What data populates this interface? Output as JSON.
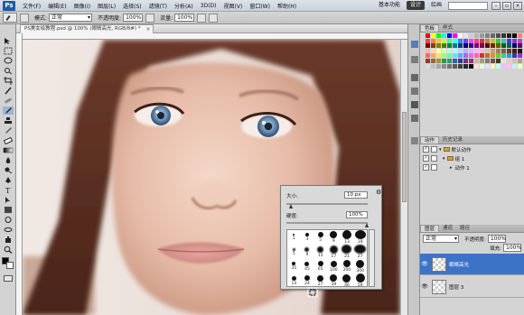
{
  "app": {
    "logo": "Ps",
    "menu": [
      "文件(F)",
      "编辑(E)",
      "图像(I)",
      "图层(L)",
      "选择(S)",
      "滤镜(T)",
      "分析(A)",
      "3D(D)",
      "视图(V)",
      "窗口(W)",
      "帮助(H)"
    ],
    "workspaces": {
      "basic": "基本功能",
      "design": "设计",
      "painting": "绘画"
    }
  },
  "options": {
    "mode_label": "模式:",
    "mode_value": "正常",
    "opacity_label": "不透明度:",
    "opacity_value": "100%",
    "flow_label": "流量:",
    "flow_value": "100%"
  },
  "document": {
    "tab_title": "PS美女绘教程.psd @ 100% (眼睛高光, RGB/8#) *",
    "close": "×"
  },
  "brush_popup": {
    "size_label": "大小:",
    "size_value": "10 px",
    "hardness_label": "硬度:",
    "hardness_value": "100%",
    "presets": [
      {
        "num": "1"
      },
      {
        "num": "3"
      },
      {
        "num": "5"
      },
      {
        "num": "9"
      },
      {
        "num": "13"
      },
      {
        "num": "19"
      },
      {
        "num": "5"
      },
      {
        "num": "9"
      },
      {
        "num": "13"
      },
      {
        "num": "17"
      },
      {
        "num": "21"
      },
      {
        "num": "27"
      },
      {
        "num": "35"
      },
      {
        "num": "45"
      },
      {
        "num": "65"
      },
      {
        "num": "100"
      },
      {
        "num": "200"
      },
      {
        "num": "300"
      },
      {
        "num": "14"
      },
      {
        "num": "24"
      },
      {
        "num": "27"
      },
      {
        "num": "39"
      },
      {
        "num": "46"
      },
      {
        "num": "59"
      }
    ]
  },
  "panels": {
    "color_tabs": [
      "色板",
      "样式"
    ],
    "actions_tabs": [
      "动作",
      "历史记录"
    ],
    "actions": [
      {
        "label": "默认动作"
      },
      {
        "label": "组 1"
      },
      {
        "label": "动作 1"
      }
    ],
    "layers_tabs": [
      "图层",
      "通道",
      "路径"
    ],
    "blend_mode": "正常",
    "opacity_label": "不透明度:",
    "opacity_value": "100%",
    "fill_label": "填充:",
    "fill_value": "100%",
    "layers": [
      {
        "name": "眼睛高光",
        "selected": true
      },
      {
        "name": "图层 3",
        "selected": false
      }
    ]
  },
  "colors": {
    "accent": "#3d73c7",
    "menubar": "#c9d0d8",
    "panel": "#d4d4d4"
  }
}
